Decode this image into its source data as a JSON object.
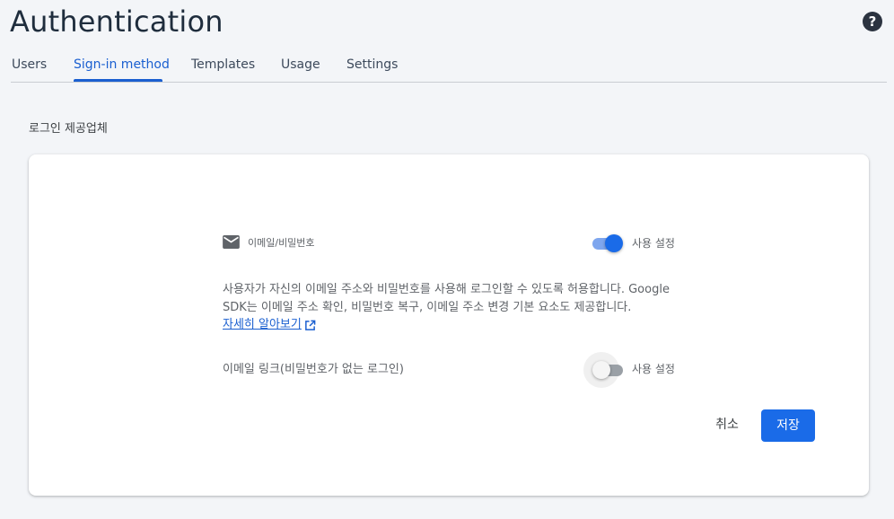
{
  "header": {
    "title": "Authentication",
    "help_icon": "help-circle-icon"
  },
  "tabs": [
    {
      "label": "Users",
      "active": false
    },
    {
      "label": "Sign-in method",
      "active": true
    },
    {
      "label": "Templates",
      "active": false
    },
    {
      "label": "Usage",
      "active": false
    },
    {
      "label": "Settings",
      "active": false
    }
  ],
  "section": {
    "title": "로그인 제공업체"
  },
  "provider": {
    "icon": "email-envelope-icon",
    "name": "이메일/비밀번호",
    "enable_label": "사용 설정",
    "enabled": true,
    "description": "사용자가 자신의 이메일 주소와 비밀번호를 사용해 로그인할 수 있도록 허용합니다. Google SDK는 이메일 주소 확인, 비밀번호 복구, 이메일 주소 변경 기본 요소도 제공합니다.",
    "learn_more": "자세히 알아보기",
    "learn_more_icon": "open-in-new-icon"
  },
  "email_link": {
    "label": "이메일 링크(비밀번호가 없는 로그인)",
    "enable_label": "사용 설정",
    "enabled": false
  },
  "actions": {
    "cancel_label": "취소",
    "save_label": "저장"
  },
  "colors": {
    "accent": "#1a6be8",
    "active_tab": "#1a5fd0",
    "background": "#f3f5f8"
  }
}
